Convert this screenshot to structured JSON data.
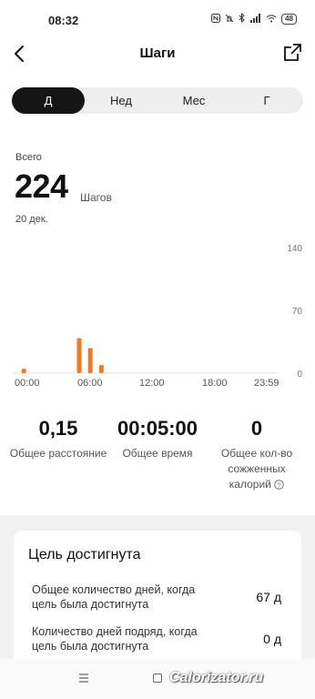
{
  "status": {
    "time": "08:32",
    "battery": "48"
  },
  "header": {
    "title": "Шаги"
  },
  "tabs": [
    "Д",
    "Нед",
    "Мес",
    "Г"
  ],
  "summary": {
    "total_label": "Всего",
    "steps": "224",
    "unit": "Шагов",
    "date": "20 дек."
  },
  "chart_data": {
    "type": "bar",
    "x_ticks": [
      "00:00",
      "06:00",
      "12:00",
      "18:00",
      "23:59"
    ],
    "y_ticks": [
      "140",
      "70",
      "0"
    ],
    "ylim": [
      0,
      140
    ],
    "bar_color": "#f07a22",
    "bars": [
      {
        "hour": 1.0,
        "value": 5
      },
      {
        "hour": 6.0,
        "value": 39
      },
      {
        "hour": 7.0,
        "value": 28
      },
      {
        "hour": 8.0,
        "value": 9
      }
    ]
  },
  "stats": [
    {
      "value": "0,15",
      "label": "Общее расстояние"
    },
    {
      "value": "00:05:00",
      "label": "Общее время"
    },
    {
      "value": "0",
      "label_line1": "Общее кол-во",
      "label_line2": "сожженных",
      "label_line3": "калорий"
    }
  ],
  "goal": {
    "title": "Цель достигнута",
    "rows": [
      {
        "label_line1": "Общее количество дней, когда",
        "label_line2": "цель была достигнута",
        "value": "67 д"
      },
      {
        "label_line1": "Количество дней подряд, когда",
        "label_line2": "цель была достигнута",
        "value": "0 д"
      }
    ]
  },
  "watermark": "Calorizator.ru",
  "colors": {
    "accent": "#f07a22",
    "active_tab": "#151515"
  }
}
